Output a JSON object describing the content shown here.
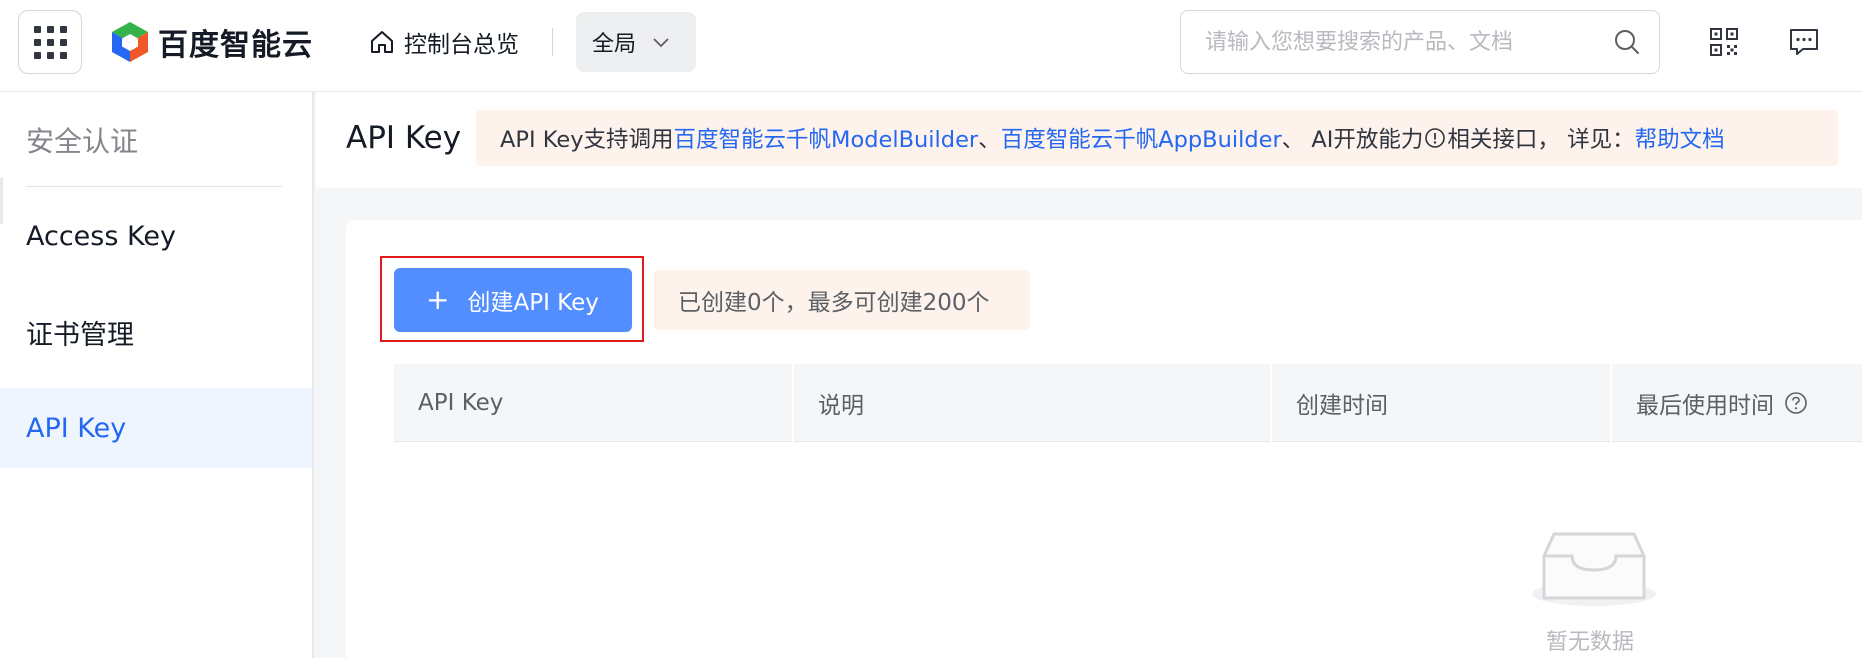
{
  "topbar": {
    "brand": "百度智能云",
    "console_label": "控制台总览",
    "region_label": "全局",
    "search_placeholder": "请输入您想要搜索的产品、文档"
  },
  "sidebar": {
    "title": "安全认证",
    "items": [
      {
        "label": "Access Key",
        "active": false
      },
      {
        "label": "证书管理",
        "active": false
      },
      {
        "label": "API Key",
        "active": true
      }
    ]
  },
  "page": {
    "title": "API Key",
    "notice": {
      "prefix": "API Key支持调用",
      "link1": "百度智能云千帆ModelBuilder",
      "sep1": "、",
      "link2": "百度智能云千帆AppBuilder",
      "mid": "、 AI开放能力",
      "suffix": "相关接口， 详见：",
      "help_link": "帮助文档"
    }
  },
  "toolbar": {
    "create_label": "创建API Key",
    "quota_text": "已创建0个，最多可创建200个"
  },
  "table": {
    "columns": [
      "API Key",
      "说明",
      "创建时间",
      "最后使用时间"
    ],
    "empty_text": "暂无数据"
  },
  "colors": {
    "accent": "#2468f2",
    "primary_button": "#528eff",
    "highlight_outline": "#e01b1b",
    "notice_bg": "#fdf3ec"
  }
}
